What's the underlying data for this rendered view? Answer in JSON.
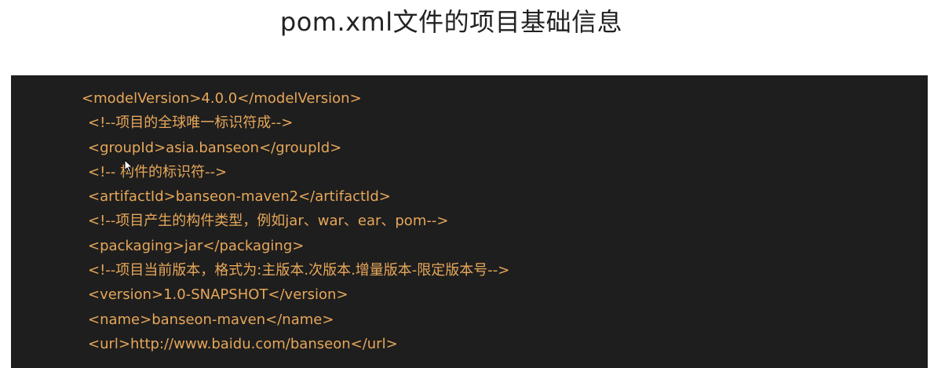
{
  "slide": {
    "title": "pom.xml文件的项目基础信息"
  },
  "code": {
    "lines": [
      "<modelVersion>4.0.0</modelVersion>",
      "<!--项目的全球唯一标识符成-->",
      "<groupId>asia.banseon</groupId>",
      "<!-- 构件的标识符-->",
      "<artifactId>banseon-maven2</artifactId>",
      "<!--项目产生的构件类型，例如jar、war、ear、pom-->",
      "<packaging>jar</packaging>",
      "<!--项目当前版本，格式为:主版本.次版本.增量版本-限定版本号-->",
      "<version>1.0-SNAPSHOT</version>",
      "<name>banseon-maven</name>",
      "<url>http://www.baidu.com/banseon</url>"
    ]
  },
  "colors": {
    "background": "#ffffff",
    "code_background": "#1e1e1e",
    "code_text": "#e7a75a",
    "title_text": "#222222"
  }
}
